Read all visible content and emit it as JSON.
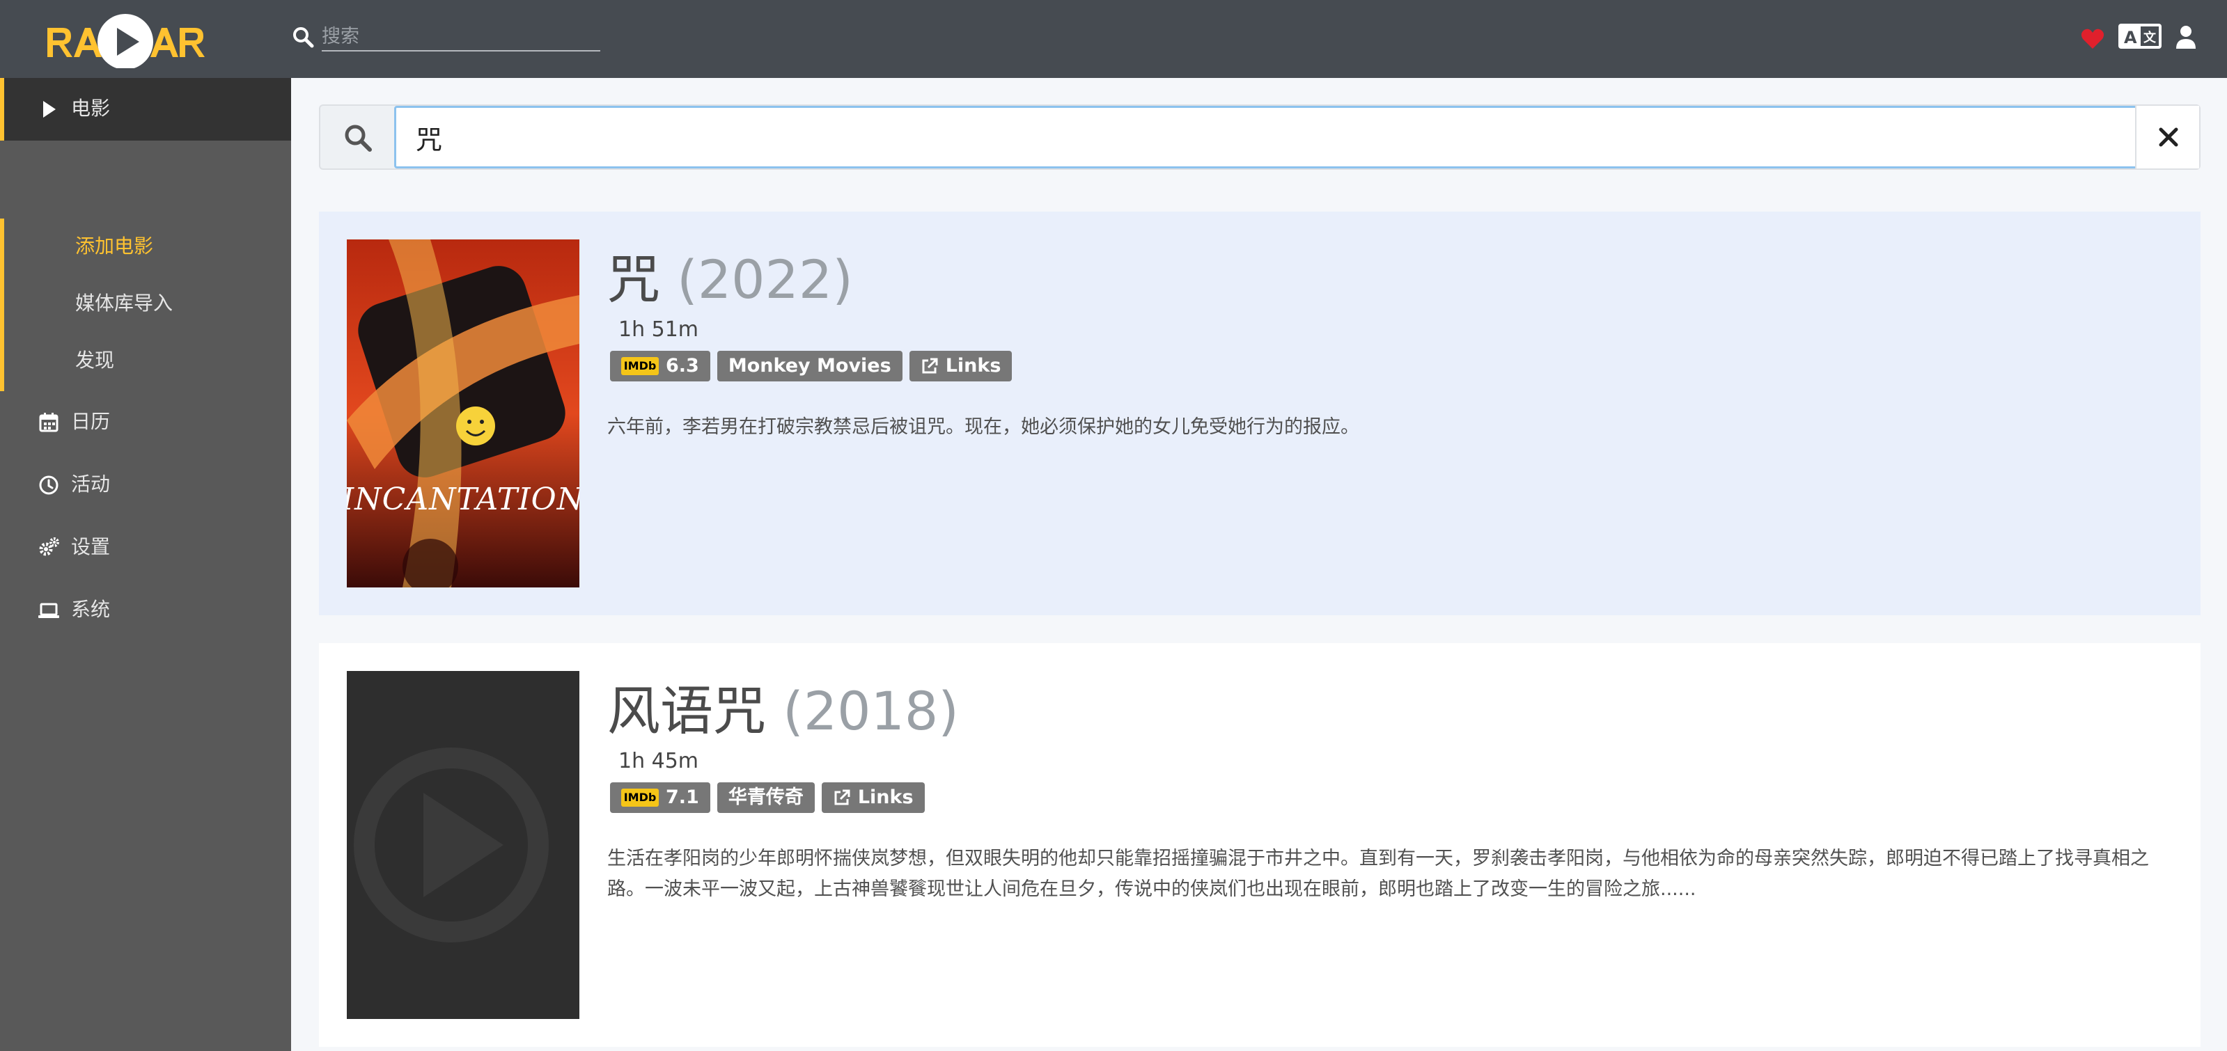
{
  "header": {
    "logo_text": "RADARR",
    "search": {
      "placeholder": "搜索",
      "value": ""
    },
    "icons": [
      "heart-icon",
      "translate-icon",
      "user-icon"
    ]
  },
  "sidebar": {
    "items": [
      {
        "label": "电影",
        "icon": "play-icon",
        "active": true
      },
      {
        "label": "日历",
        "icon": "calendar-icon"
      },
      {
        "label": "活动",
        "icon": "clock-icon"
      },
      {
        "label": "设置",
        "icon": "cogs-icon"
      },
      {
        "label": "系统",
        "icon": "laptop-icon"
      }
    ],
    "sub_items": [
      {
        "label": "添加电影",
        "active": true
      },
      {
        "label": "媒体库导入"
      },
      {
        "label": "发现"
      }
    ]
  },
  "search": {
    "value": "咒"
  },
  "results": [
    {
      "title": "咒",
      "year": "(2022)",
      "runtime": "1h 51m",
      "rating": "6.3",
      "studio": "Monkey Movies",
      "links_label": "Links",
      "poster_text": "INCANTATION",
      "overview": "六年前，李若男在打破宗教禁忌后被诅咒。现在，她必须保护她的女儿免受她行为的报应。"
    },
    {
      "title": "风语咒",
      "year": "(2018)",
      "runtime": "1h 45m",
      "rating": "7.1",
      "studio": "华青传奇",
      "links_label": "Links",
      "overview": "生活在孝阳岗的少年郎明怀揣侠岚梦想，但双眼失明的他却只能靠招摇撞骗混于市井之中。直到有一天，罗刹袭击孝阳岗，与他相依为命的母亲突然失踪，郎明迫不得已踏上了找寻真相之路。一波未平一波又起，上古神兽饕餮现世让人间危在旦夕，传说中的侠岚们也出现在眼前，郎明也踏上了改变一生的冒险之旅......"
    }
  ],
  "imdb_label": "IMDb",
  "colors": {
    "accent": "#ffc230",
    "header_bg": "#464b51",
    "sidebar_bg": "#595959",
    "heart": "#e0202c"
  }
}
